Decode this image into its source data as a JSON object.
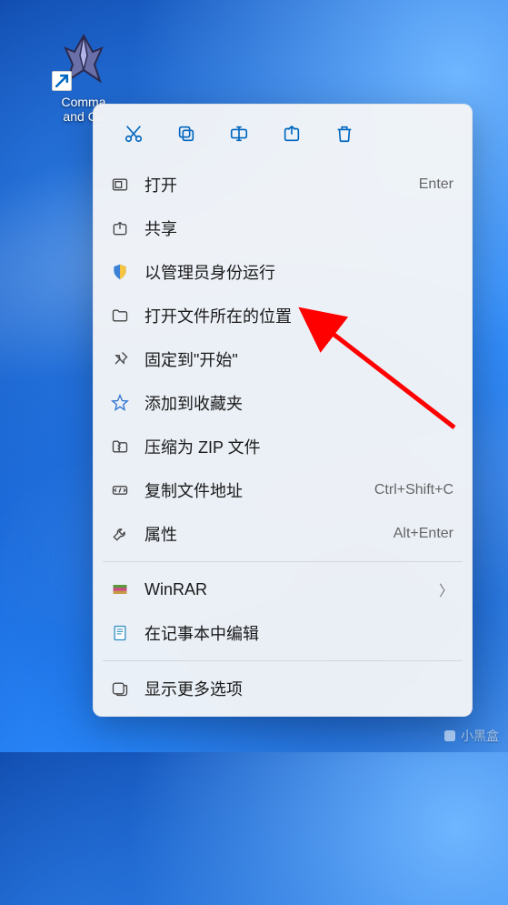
{
  "desktop": {
    "icon_label": "Command and Conquer",
    "icon_label_visible": "Comma\nand Co",
    "shortcut_indicator": "↗"
  },
  "context_menu": {
    "top_actions": [
      {
        "name": "cut",
        "title": "剪切"
      },
      {
        "name": "copy",
        "title": "复制"
      },
      {
        "name": "rename",
        "title": "重命名"
      },
      {
        "name": "share",
        "title": "共享"
      },
      {
        "name": "delete",
        "title": "删除"
      }
    ],
    "items": [
      {
        "icon": "open",
        "label": "打开",
        "shortcut": "Enter"
      },
      {
        "icon": "share",
        "label": "共享"
      },
      {
        "icon": "shield",
        "label": "以管理员身份运行"
      },
      {
        "icon": "folder",
        "label": "打开文件所在的位置"
      },
      {
        "icon": "pin",
        "label": "固定到\"开始\""
      },
      {
        "icon": "star",
        "label": "添加到收藏夹"
      },
      {
        "icon": "zip",
        "label": "压缩为 ZIP 文件"
      },
      {
        "icon": "path",
        "label": "复制文件地址",
        "shortcut": "Ctrl+Shift+C"
      },
      {
        "icon": "wrench",
        "label": "属性",
        "shortcut": "Alt+Enter"
      }
    ],
    "extra_items": [
      {
        "icon": "winrar",
        "label": "WinRAR",
        "has_submenu": true
      },
      {
        "icon": "notepad",
        "label": "在记事本中编辑"
      }
    ],
    "more": {
      "icon": "more",
      "label": "显示更多选项"
    }
  },
  "annotation": {
    "arrow_color": "#ff0000"
  },
  "watermark": {
    "text": "小黑盒"
  }
}
